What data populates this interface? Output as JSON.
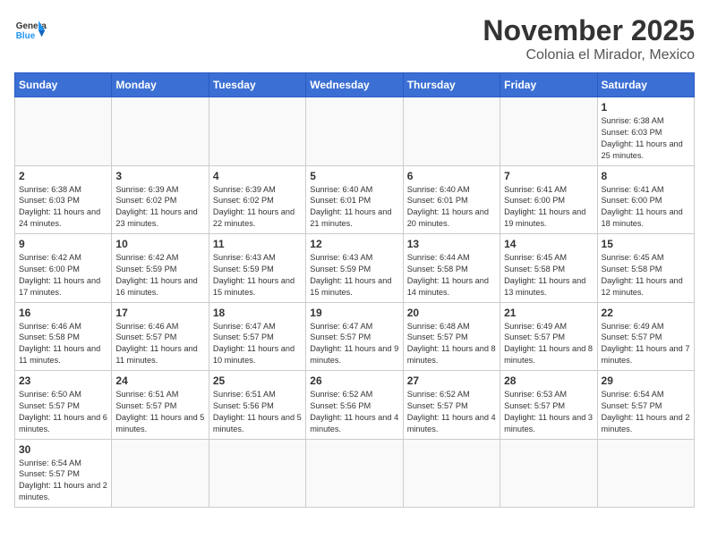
{
  "header": {
    "logo_general": "General",
    "logo_blue": "Blue",
    "month_title": "November 2025",
    "subtitle": "Colonia el Mirador, Mexico"
  },
  "weekdays": [
    "Sunday",
    "Monday",
    "Tuesday",
    "Wednesday",
    "Thursday",
    "Friday",
    "Saturday"
  ],
  "weeks": [
    [
      {
        "day": "",
        "info": ""
      },
      {
        "day": "",
        "info": ""
      },
      {
        "day": "",
        "info": ""
      },
      {
        "day": "",
        "info": ""
      },
      {
        "day": "",
        "info": ""
      },
      {
        "day": "",
        "info": ""
      },
      {
        "day": "1",
        "info": "Sunrise: 6:38 AM\nSunset: 6:03 PM\nDaylight: 11 hours\nand 25 minutes."
      }
    ],
    [
      {
        "day": "2",
        "info": "Sunrise: 6:38 AM\nSunset: 6:03 PM\nDaylight: 11 hours\nand 24 minutes."
      },
      {
        "day": "3",
        "info": "Sunrise: 6:39 AM\nSunset: 6:02 PM\nDaylight: 11 hours\nand 23 minutes."
      },
      {
        "day": "4",
        "info": "Sunrise: 6:39 AM\nSunset: 6:02 PM\nDaylight: 11 hours\nand 22 minutes."
      },
      {
        "day": "5",
        "info": "Sunrise: 6:40 AM\nSunset: 6:01 PM\nDaylight: 11 hours\nand 21 minutes."
      },
      {
        "day": "6",
        "info": "Sunrise: 6:40 AM\nSunset: 6:01 PM\nDaylight: 11 hours\nand 20 minutes."
      },
      {
        "day": "7",
        "info": "Sunrise: 6:41 AM\nSunset: 6:00 PM\nDaylight: 11 hours\nand 19 minutes."
      },
      {
        "day": "8",
        "info": "Sunrise: 6:41 AM\nSunset: 6:00 PM\nDaylight: 11 hours\nand 18 minutes."
      }
    ],
    [
      {
        "day": "9",
        "info": "Sunrise: 6:42 AM\nSunset: 6:00 PM\nDaylight: 11 hours\nand 17 minutes."
      },
      {
        "day": "10",
        "info": "Sunrise: 6:42 AM\nSunset: 5:59 PM\nDaylight: 11 hours\nand 16 minutes."
      },
      {
        "day": "11",
        "info": "Sunrise: 6:43 AM\nSunset: 5:59 PM\nDaylight: 11 hours\nand 15 minutes."
      },
      {
        "day": "12",
        "info": "Sunrise: 6:43 AM\nSunset: 5:59 PM\nDaylight: 11 hours\nand 15 minutes."
      },
      {
        "day": "13",
        "info": "Sunrise: 6:44 AM\nSunset: 5:58 PM\nDaylight: 11 hours\nand 14 minutes."
      },
      {
        "day": "14",
        "info": "Sunrise: 6:45 AM\nSunset: 5:58 PM\nDaylight: 11 hours\nand 13 minutes."
      },
      {
        "day": "15",
        "info": "Sunrise: 6:45 AM\nSunset: 5:58 PM\nDaylight: 11 hours\nand 12 minutes."
      }
    ],
    [
      {
        "day": "16",
        "info": "Sunrise: 6:46 AM\nSunset: 5:58 PM\nDaylight: 11 hours\nand 11 minutes."
      },
      {
        "day": "17",
        "info": "Sunrise: 6:46 AM\nSunset: 5:57 PM\nDaylight: 11 hours\nand 11 minutes."
      },
      {
        "day": "18",
        "info": "Sunrise: 6:47 AM\nSunset: 5:57 PM\nDaylight: 11 hours\nand 10 minutes."
      },
      {
        "day": "19",
        "info": "Sunrise: 6:47 AM\nSunset: 5:57 PM\nDaylight: 11 hours\nand 9 minutes."
      },
      {
        "day": "20",
        "info": "Sunrise: 6:48 AM\nSunset: 5:57 PM\nDaylight: 11 hours\nand 8 minutes."
      },
      {
        "day": "21",
        "info": "Sunrise: 6:49 AM\nSunset: 5:57 PM\nDaylight: 11 hours\nand 8 minutes."
      },
      {
        "day": "22",
        "info": "Sunrise: 6:49 AM\nSunset: 5:57 PM\nDaylight: 11 hours\nand 7 minutes."
      }
    ],
    [
      {
        "day": "23",
        "info": "Sunrise: 6:50 AM\nSunset: 5:57 PM\nDaylight: 11 hours\nand 6 minutes."
      },
      {
        "day": "24",
        "info": "Sunrise: 6:51 AM\nSunset: 5:57 PM\nDaylight: 11 hours\nand 5 minutes."
      },
      {
        "day": "25",
        "info": "Sunrise: 6:51 AM\nSunset: 5:56 PM\nDaylight: 11 hours\nand 5 minutes."
      },
      {
        "day": "26",
        "info": "Sunrise: 6:52 AM\nSunset: 5:56 PM\nDaylight: 11 hours\nand 4 minutes."
      },
      {
        "day": "27",
        "info": "Sunrise: 6:52 AM\nSunset: 5:57 PM\nDaylight: 11 hours\nand 4 minutes."
      },
      {
        "day": "28",
        "info": "Sunrise: 6:53 AM\nSunset: 5:57 PM\nDaylight: 11 hours\nand 3 minutes."
      },
      {
        "day": "29",
        "info": "Sunrise: 6:54 AM\nSunset: 5:57 PM\nDaylight: 11 hours\nand 2 minutes."
      }
    ],
    [
      {
        "day": "30",
        "info": "Sunrise: 6:54 AM\nSunset: 5:57 PM\nDaylight: 11 hours\nand 2 minutes."
      },
      {
        "day": "",
        "info": ""
      },
      {
        "day": "",
        "info": ""
      },
      {
        "day": "",
        "info": ""
      },
      {
        "day": "",
        "info": ""
      },
      {
        "day": "",
        "info": ""
      },
      {
        "day": "",
        "info": ""
      }
    ]
  ]
}
